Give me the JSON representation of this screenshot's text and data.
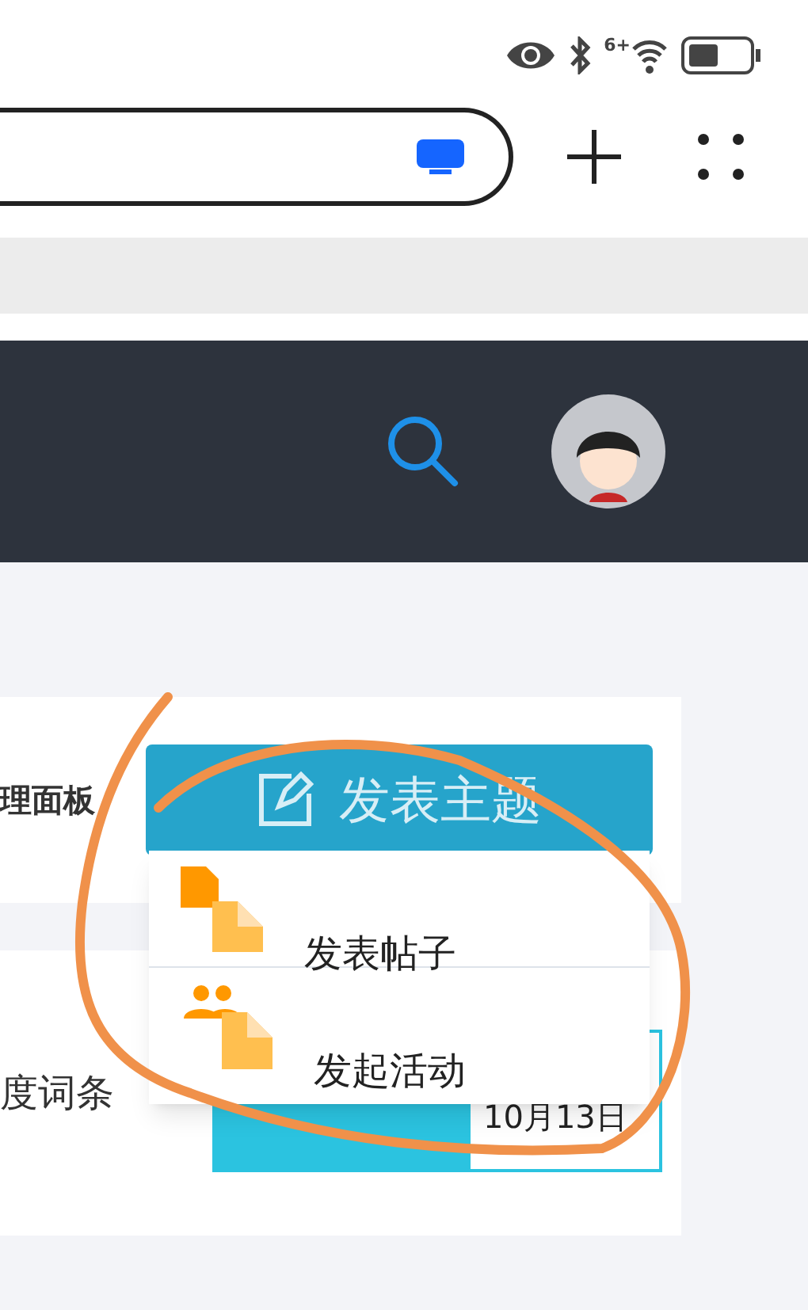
{
  "status_bar": {
    "network": "6+"
  },
  "panel": {
    "side_label": "理面板",
    "post_button": "发表主题",
    "row_label": "度词条",
    "date": "10月13日"
  },
  "dropdown": {
    "items": [
      {
        "kind": "post",
        "label": "发表帖子"
      },
      {
        "kind": "event",
        "label": "发起活动"
      }
    ]
  }
}
